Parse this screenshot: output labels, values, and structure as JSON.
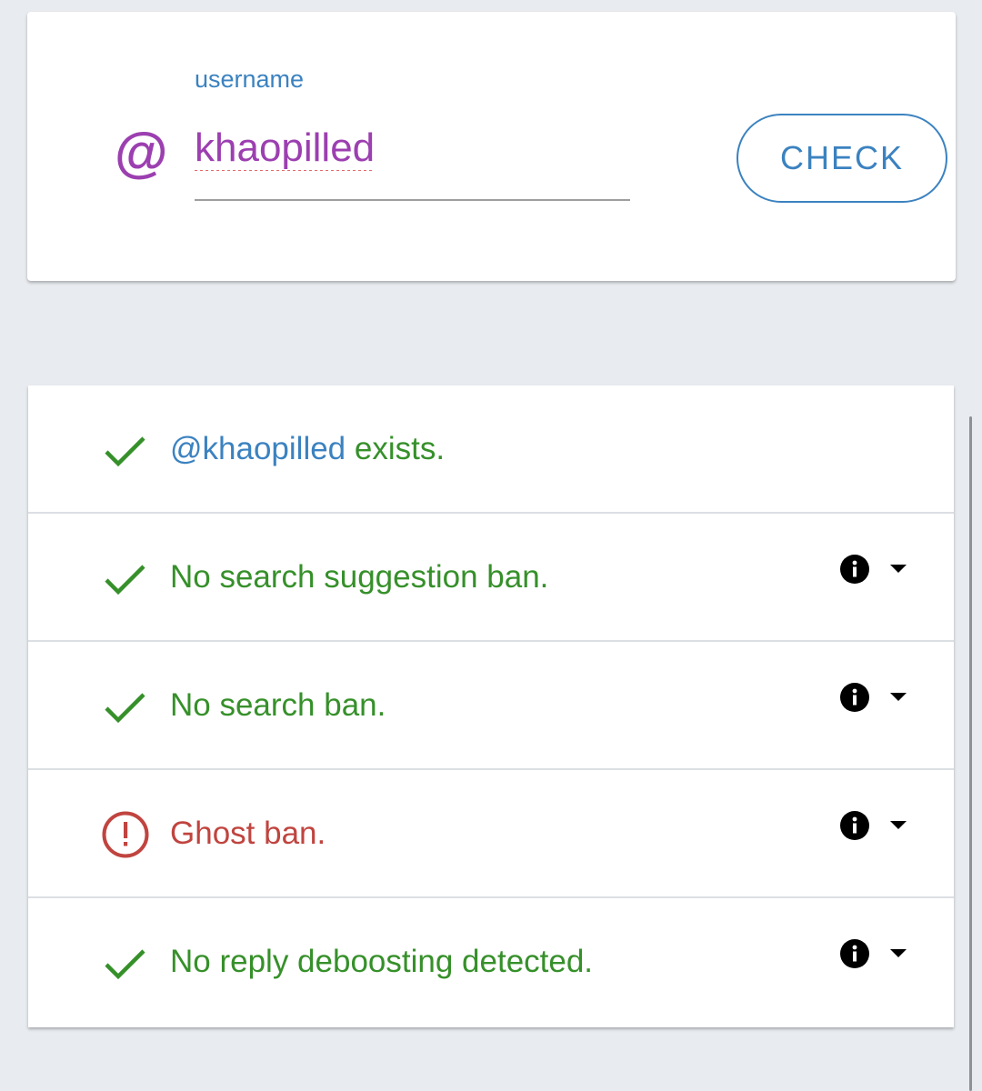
{
  "input_card": {
    "field_label": "username",
    "prefix_symbol": "@",
    "username_value": "khaopilled",
    "check_button_label": "CHECK"
  },
  "results": [
    {
      "status": "ok",
      "icon": "check-icon",
      "handle": "@khaopilled",
      "text": " exists.",
      "has_info": false
    },
    {
      "status": "ok",
      "icon": "check-icon",
      "text": "No search suggestion ban.",
      "has_info": true
    },
    {
      "status": "ok",
      "icon": "check-icon",
      "text": "No search ban.",
      "has_info": true
    },
    {
      "status": "warning",
      "icon": "alert-circle-icon",
      "text": "Ghost ban.",
      "has_info": true
    },
    {
      "status": "ok",
      "icon": "check-icon",
      "text": "No reply deboosting detected.",
      "has_info": true
    }
  ],
  "colors": {
    "ok": "#36902a",
    "warning": "#c0443f",
    "accent": "#3b82c0",
    "username": "#9c3fb0",
    "background": "#e8ebef"
  }
}
